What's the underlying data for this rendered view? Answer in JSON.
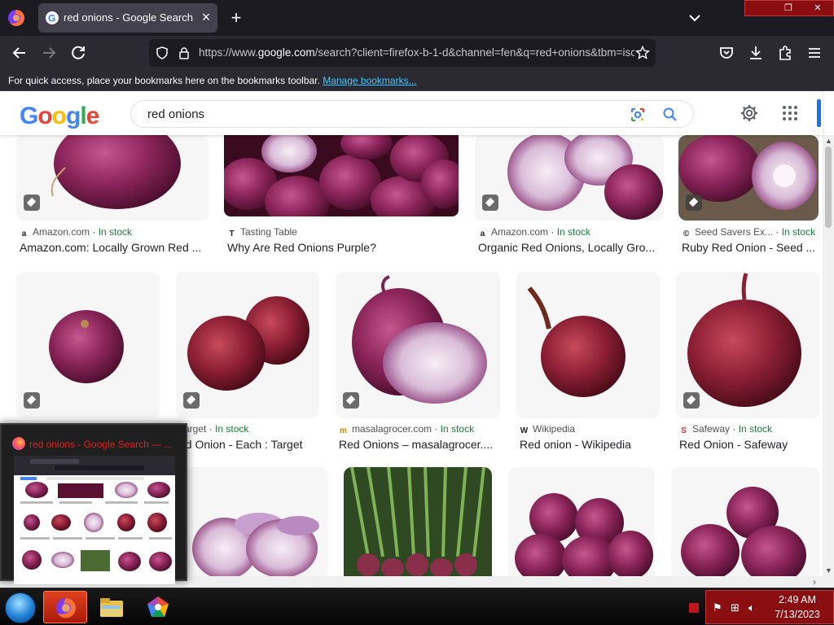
{
  "browser": {
    "tab_title": "red onions - Google Search",
    "url_prefix": "https://www.",
    "url_host": "google.com",
    "url_rest": "/search?client=firefox-b-1-d&channel=fen&q=red+onions&tbm=isch",
    "bookmarks_msg": "For quick access, place your bookmarks here on the bookmarks toolbar.",
    "bookmarks_link": "Manage bookmarks..."
  },
  "google": {
    "logo_letters": [
      "G",
      "o",
      "o",
      "g",
      "l",
      "e"
    ],
    "logo_colors": [
      "#4285f4",
      "#ea4335",
      "#fbbc05",
      "#4285f4",
      "#34a853",
      "#ea4335"
    ],
    "query": "red onions"
  },
  "results": {
    "row1": [
      {
        "source": "Amazon.com",
        "stock": "In stock",
        "title": "Amazon.com: Locally Grown Red ...",
        "fav": "a"
      },
      {
        "source": "Tasting Table",
        "stock": "",
        "title": "Why Are Red Onions Purple?",
        "fav": "T"
      },
      {
        "source": "Amazon.com",
        "stock": "In stock",
        "title": "Organic Red Onions, Locally Gro...",
        "fav": "a"
      },
      {
        "source": "Seed Savers Ex...",
        "stock": "In stock",
        "title": "Ruby Red Onion - Seed ...",
        "fav": "©"
      }
    ],
    "row2": [
      {
        "source": "",
        "stock": "",
        "title": "",
        "fav": ""
      },
      {
        "source": "Target",
        "stock": "In stock",
        "title": "ed Onion - Each : Target",
        "fav": ""
      },
      {
        "source": "masalagrocer.com",
        "stock": "In stock",
        "title": "Red Onions – masalagrocer....",
        "fav": "m"
      },
      {
        "source": "Wikipedia",
        "stock": "",
        "title": "Red onion - Wikipedia",
        "fav": "W"
      },
      {
        "source": "Safeway",
        "stock": "In stock",
        "title": "Red Onion - Safeway",
        "fav": "S"
      }
    ],
    "stock_sep": " · "
  },
  "preview": {
    "title": "red onions - Google Search — ..."
  },
  "taskbar": {
    "time": "2:49 AM",
    "date": "7/13/2023"
  },
  "colors": {
    "onion_dark": "#6e1a46",
    "onion_mid": "#9b2d68",
    "onion_light": "#d8b8d6",
    "accent_blue": "#1a73e8"
  }
}
